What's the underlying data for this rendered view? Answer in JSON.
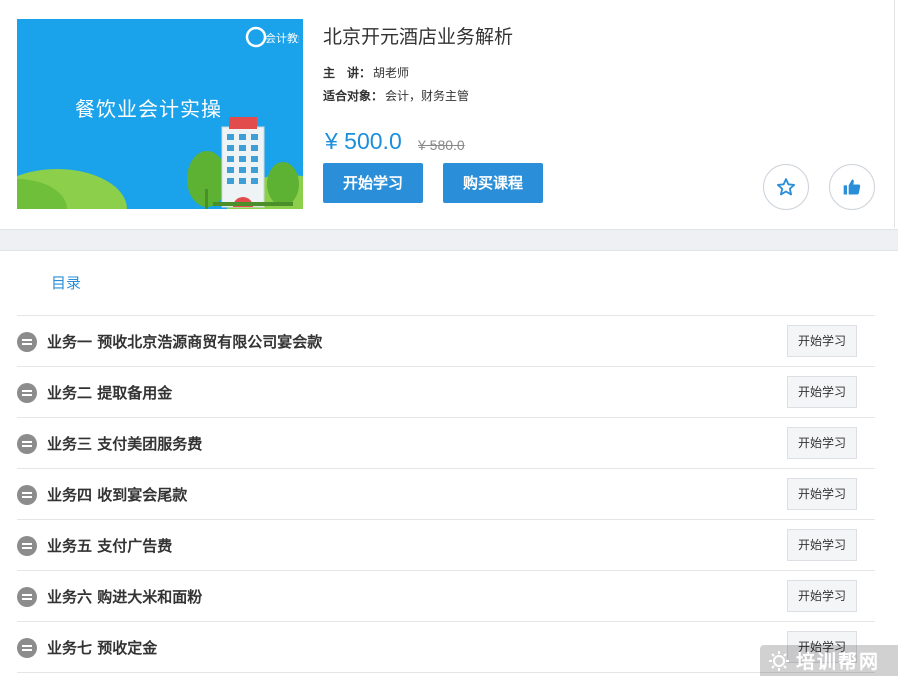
{
  "course": {
    "thumbnail_title": "餐饮业会计实操",
    "thumbnail_logo": "会计教练",
    "thumbnail_sign": "HOTEL",
    "title": "北京开元酒店业务解析",
    "lecturer_label": "主　讲：",
    "lecturer": "胡老师",
    "audience_label": "适合对象：",
    "audience": "会计，财务主管",
    "price": "¥ 500.0",
    "old_price": "¥ 580.0",
    "start_button": "开始学习",
    "buy_button": "购买课程",
    "favorite_icon": "star-icon",
    "like_icon": "thumbs-up-icon"
  },
  "toc": {
    "title": "目录",
    "items": [
      {
        "label": "业务一 预收北京浩源商贸有限公司宴会款",
        "button": "开始学习"
      },
      {
        "label": "业务二 提取备用金",
        "button": "开始学习"
      },
      {
        "label": "业务三 支付美团服务费",
        "button": "开始学习"
      },
      {
        "label": "业务四 收到宴会尾款",
        "button": "开始学习"
      },
      {
        "label": "业务五 支付广告费",
        "button": "开始学习"
      },
      {
        "label": "业务六 购进大米和面粉",
        "button": "开始学习"
      },
      {
        "label": "业务七 预收定金",
        "button": "开始学习"
      }
    ]
  },
  "watermark": {
    "text": "培训帮网"
  },
  "colors": {
    "accent": "#2a8fd8",
    "thumb_bg": "#1aa2ea",
    "separator": "#eef0f3"
  }
}
